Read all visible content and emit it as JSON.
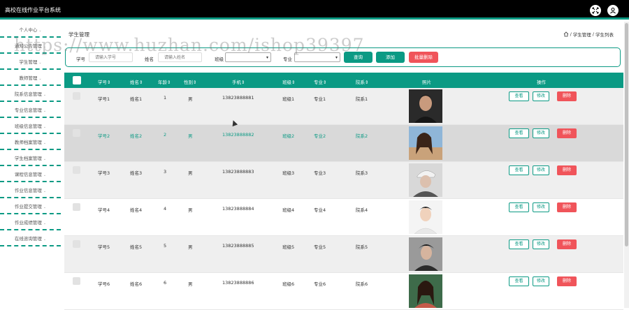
{
  "app": {
    "title": "高校在线作业平台系统"
  },
  "sidebar": {
    "items": [
      {
        "label": "个人中心"
      },
      {
        "label": "通知公告管理"
      },
      {
        "label": "学生管理"
      },
      {
        "label": "教师管理"
      },
      {
        "label": "院系信息管理"
      },
      {
        "label": "专业信息管理"
      },
      {
        "label": "班级信息管理"
      },
      {
        "label": "教师档案管理"
      },
      {
        "label": "学生档案管理"
      },
      {
        "label": "课程信息管理"
      },
      {
        "label": "作业信息管理"
      },
      {
        "label": "作业提交管理"
      },
      {
        "label": "作业成绩管理"
      },
      {
        "label": "在线咨询管理"
      }
    ]
  },
  "page": {
    "title": "学生管理",
    "breadcrumb": [
      "学生管理",
      "学生列表"
    ],
    "breadcrumb_sep": "/"
  },
  "search": {
    "student_no_label": "学号",
    "student_no_placeholder": "请输入学号",
    "name_label": "姓名",
    "name_placeholder": "请输入姓名",
    "class_label": "班级",
    "major_label": "专业",
    "query_btn": "查询",
    "add_btn": "添加",
    "batch_delete_btn": "批量删除"
  },
  "table": {
    "headers": [
      "学号",
      "姓名",
      "年龄",
      "性别",
      "手机",
      "班级",
      "专业",
      "院系",
      "照片",
      "操作"
    ],
    "sort_mark": "⇕",
    "actions": {
      "view": "查看",
      "edit": "修改",
      "delete": "删除"
    },
    "rows": [
      {
        "no": "学号1",
        "name": "姓名1",
        "age": "1",
        "gender": "男",
        "phone": "13823888881",
        "class": "班级1",
        "major": "专业1",
        "dept": "院系1"
      },
      {
        "no": "学号2",
        "name": "姓名2",
        "age": "2",
        "gender": "男",
        "phone": "13823888882",
        "class": "班级2",
        "major": "专业2",
        "dept": "院系2"
      },
      {
        "no": "学号3",
        "name": "姓名3",
        "age": "3",
        "gender": "男",
        "phone": "13823888883",
        "class": "班级3",
        "major": "专业3",
        "dept": "院系3"
      },
      {
        "no": "学号4",
        "name": "姓名4",
        "age": "4",
        "gender": "男",
        "phone": "13823888884",
        "class": "班级4",
        "major": "专业4",
        "dept": "院系4"
      },
      {
        "no": "学号5",
        "name": "姓名5",
        "age": "5",
        "gender": "男",
        "phone": "13823888885",
        "class": "班级5",
        "major": "专业5",
        "dept": "院系5"
      },
      {
        "no": "学号6",
        "name": "姓名6",
        "age": "6",
        "gender": "男",
        "phone": "13823888886",
        "class": "班级6",
        "major": "专业6",
        "dept": "院系6"
      }
    ]
  },
  "watermark": {
    "text": "https://www.huzhan.com/ishop39397"
  },
  "colors": {
    "accent": "#0b9a84",
    "danger": "#f0545a",
    "topbar": "#000000"
  }
}
